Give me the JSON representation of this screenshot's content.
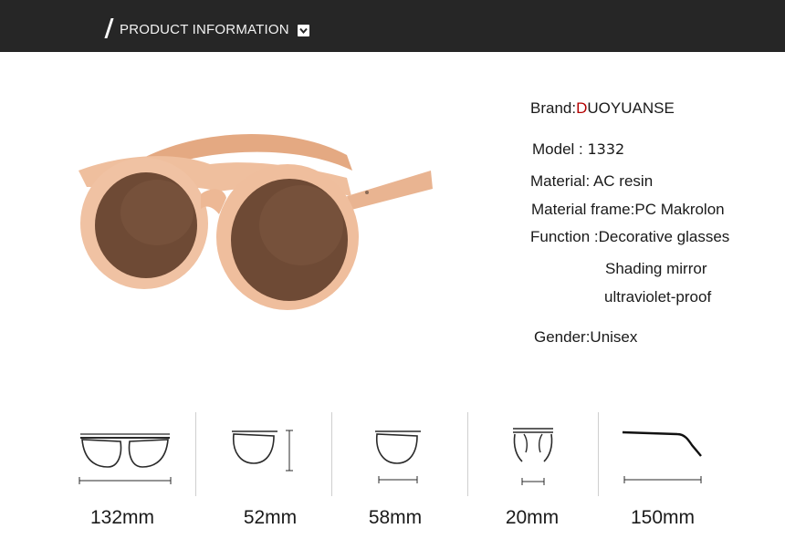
{
  "header": {
    "title": "PRODUCT INFORMATION"
  },
  "product": {
    "frame_color": "#ecb896",
    "lens_color": "#6e4a35"
  },
  "specs": {
    "brand_label": "Brand:",
    "brand_initial": "D",
    "brand_rest": "UOYUANSE",
    "model_label": "Model : ",
    "model_value": "1332",
    "material": "Material: AC resin",
    "material_frame": "Material frame:PC Makrolon",
    "function": "Function :Decorative glasses",
    "function_extra_1": "Shading mirror",
    "function_extra_2": "ultraviolet-proof",
    "gender": "Gender:Unisex"
  },
  "dimensions": [
    {
      "label": "132mm",
      "icon": "frame-width-icon"
    },
    {
      "label": "52mm",
      "icon": "lens-height-icon"
    },
    {
      "label": "58mm",
      "icon": "lens-width-icon"
    },
    {
      "label": "20mm",
      "icon": "bridge-width-icon"
    },
    {
      "label": "150mm",
      "icon": "temple-length-icon"
    }
  ]
}
